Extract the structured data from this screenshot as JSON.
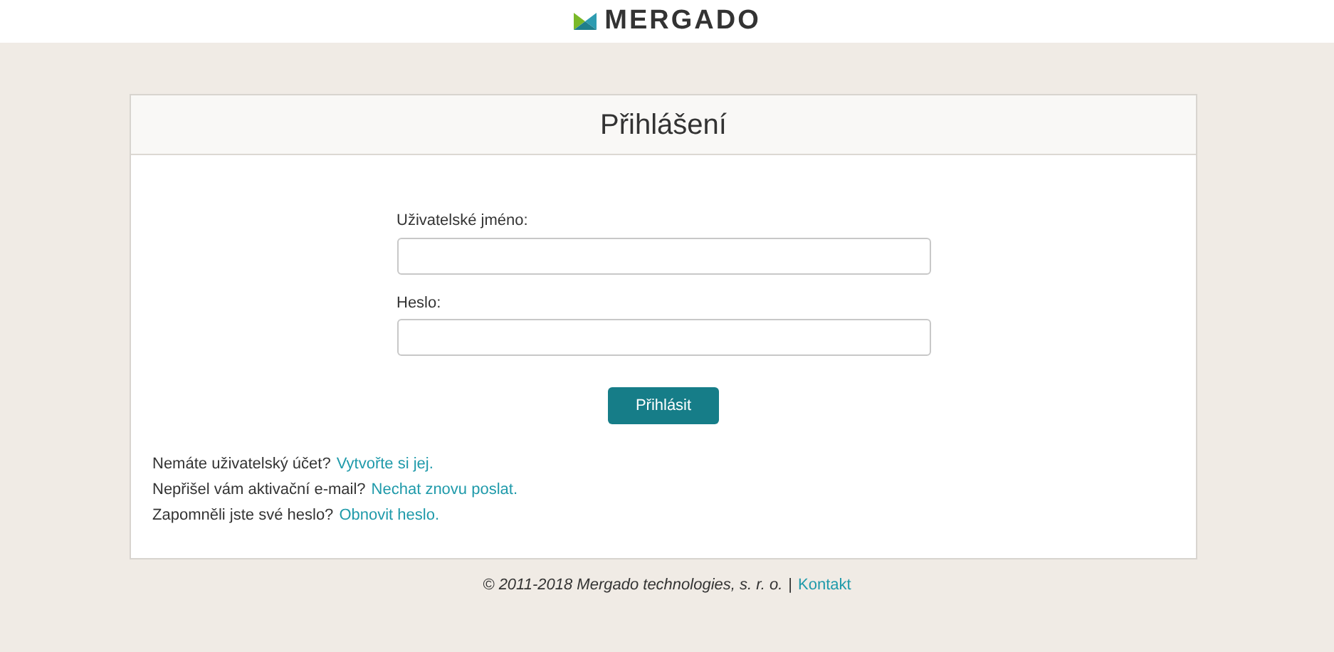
{
  "header": {
    "logo_text": "MERGADO"
  },
  "card": {
    "title": "Přihlášení",
    "fields": [
      {
        "label": "Uživatelské jméno:"
      },
      {
        "label": "Heslo:"
      }
    ],
    "submit": "Přihlásit",
    "help_lines": [
      {
        "text": "Nemáte uživatelský účet?",
        "link": "Vytvořte si jej."
      },
      {
        "text": "Nepřišel vám aktivační e-mail?",
        "link": "Nechat znovu poslat."
      },
      {
        "text": "Zapomněli jste své heslo?",
        "link": "Obnovit heslo."
      }
    ]
  },
  "footer": {
    "copyright": "© 2011-2018 Mergado technologies, s. r. o.",
    "separator": "|",
    "link": "Kontakt"
  }
}
